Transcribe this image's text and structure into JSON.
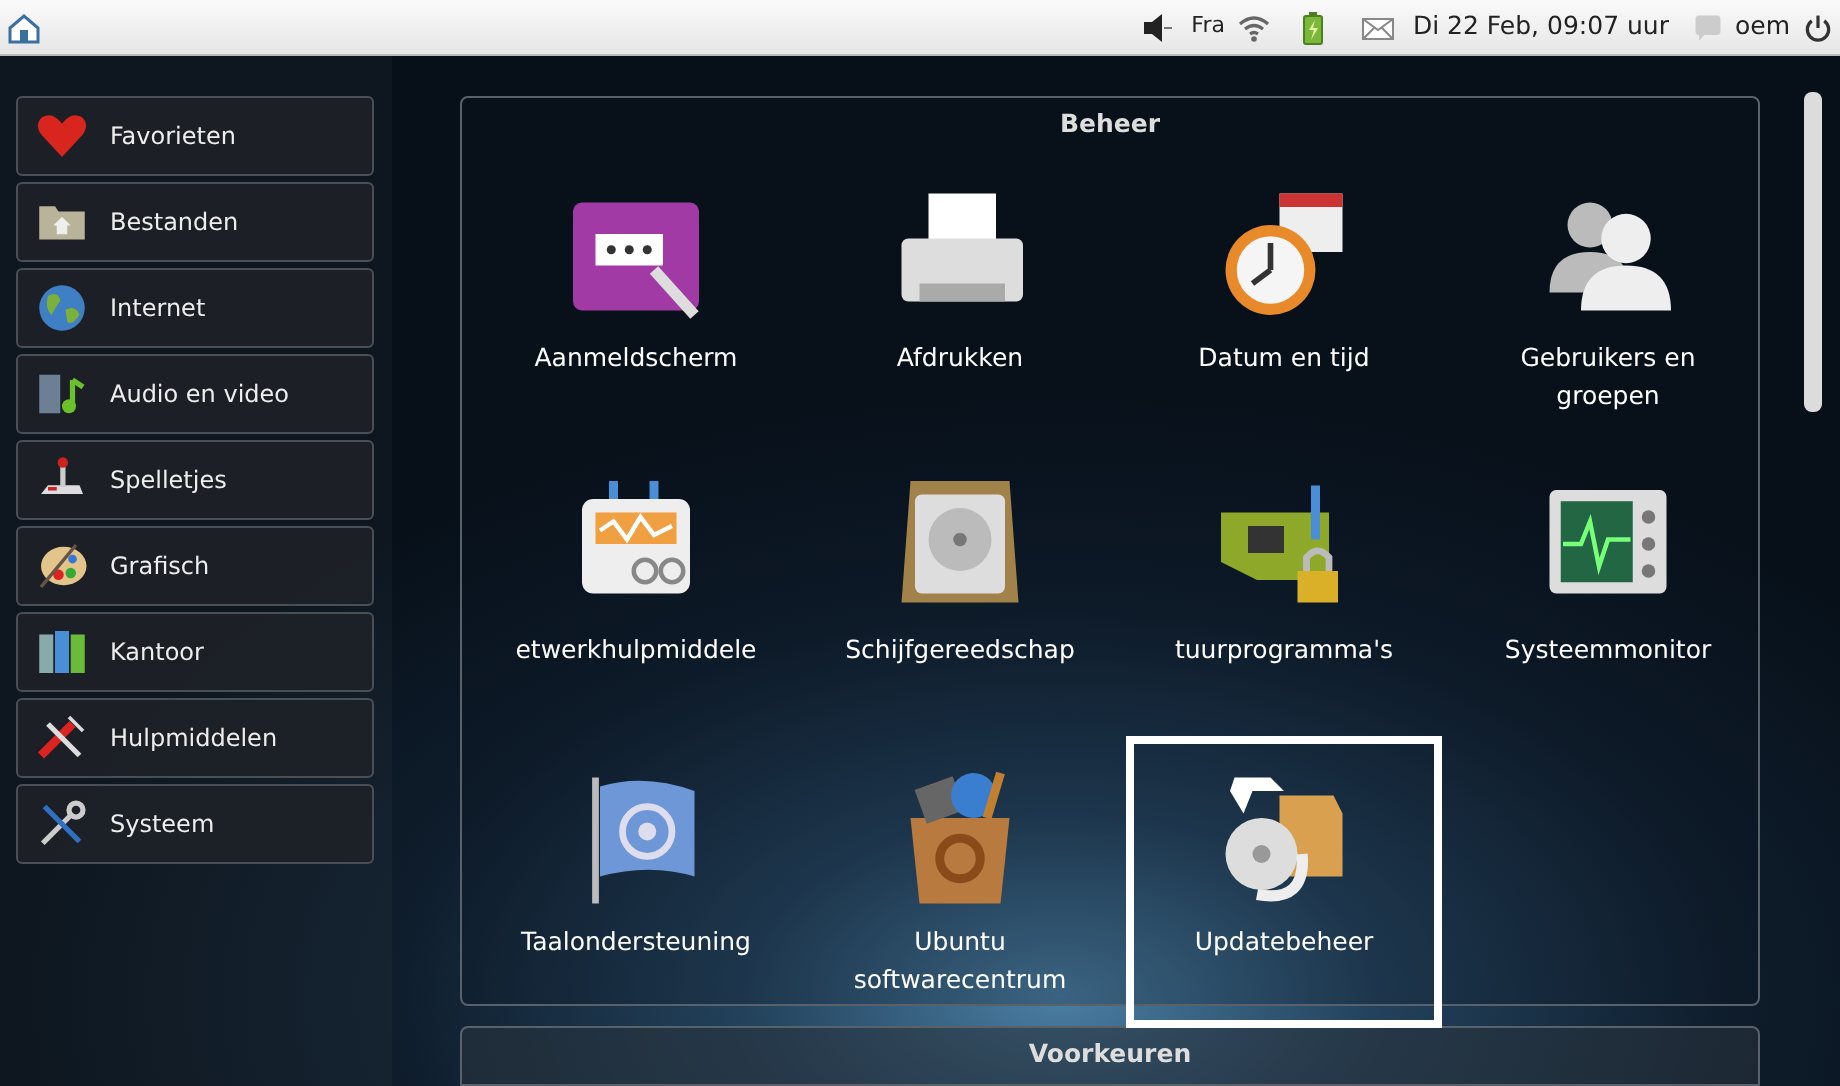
{
  "top_bar": {
    "keyboard_layout": "Fra",
    "clock": "Di 22 Feb, 09:07 uur",
    "user": "oem"
  },
  "sidebar": {
    "items": [
      {
        "label": "Favorieten"
      },
      {
        "label": "Bestanden"
      },
      {
        "label": "Internet"
      },
      {
        "label": "Audio en video"
      },
      {
        "label": "Spelletjes"
      },
      {
        "label": "Grafisch"
      },
      {
        "label": "Kantoor"
      },
      {
        "label": "Hulpmiddelen"
      },
      {
        "label": "Systeem"
      }
    ]
  },
  "sections": [
    {
      "title": "Beheer",
      "items": [
        {
          "label": "Aanmeldscherm",
          "selected": false
        },
        {
          "label": "Afdrukken",
          "selected": false
        },
        {
          "label": "Datum en tijd",
          "selected": false
        },
        {
          "label": "Gebruikers en groepen",
          "selected": false
        },
        {
          "label": "etwerkhulpmiddele",
          "selected": false
        },
        {
          "label": "Schijfgereedschap",
          "selected": false
        },
        {
          "label": "tuurprogramma's",
          "selected": false
        },
        {
          "label": "Systeemmonitor",
          "selected": false
        },
        {
          "label": "Taalondersteuning",
          "selected": false
        },
        {
          "label": "Ubuntu softwarecentrum",
          "selected": false
        },
        {
          "label": "Updatebeheer",
          "selected": true
        }
      ]
    },
    {
      "title": "Voorkeuren"
    }
  ]
}
